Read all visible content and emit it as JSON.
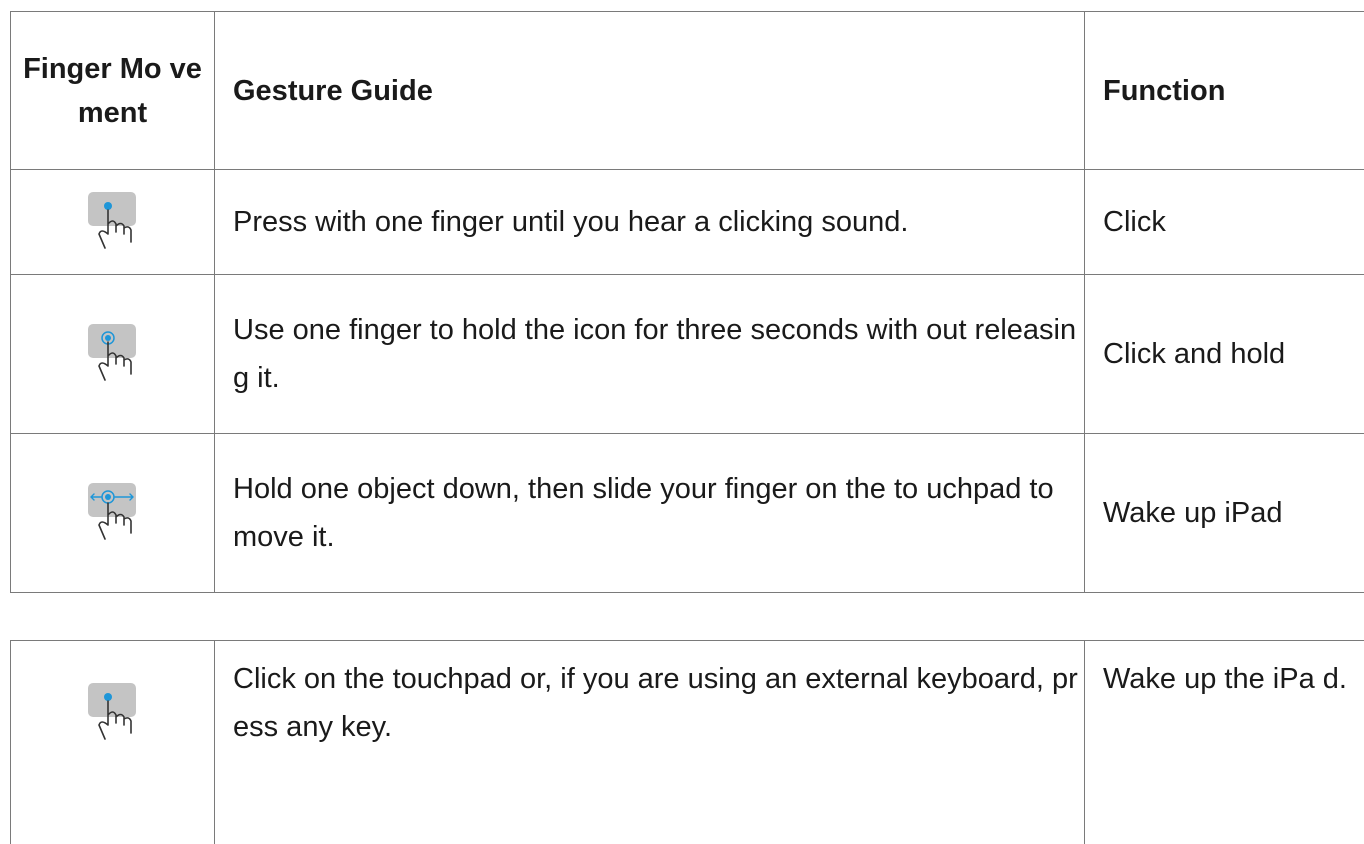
{
  "header": {
    "col_movement": "Finger Mo vement",
    "col_guide": "Gesture Guide",
    "col_function": "Function"
  },
  "rows": [
    {
      "icon": "one-finger-click-icon",
      "guide": "Press with one finger until you hear a clicking sound.",
      "function": "Click"
    },
    {
      "icon": "one-finger-hold-icon",
      "guide": "Use one finger to hold the icon for three seconds with out releasing it.",
      "function": "Click and hold"
    },
    {
      "icon": "one-finger-drag-icon",
      "guide": "Hold one object down, then slide your finger on the to uchpad to move it.",
      "function": "Wake up iPad"
    }
  ],
  "continuation_rows": [
    {
      "icon": "one-finger-click-icon",
      "guide": "Click on the touchpad or, if you are using an external keyboard, press any key.",
      "function": "Wake up the iPa d."
    }
  ],
  "colors": {
    "touchpad": "#c4c4c4",
    "touch_point": "#1e96d8",
    "border": "#7a7a7a"
  }
}
